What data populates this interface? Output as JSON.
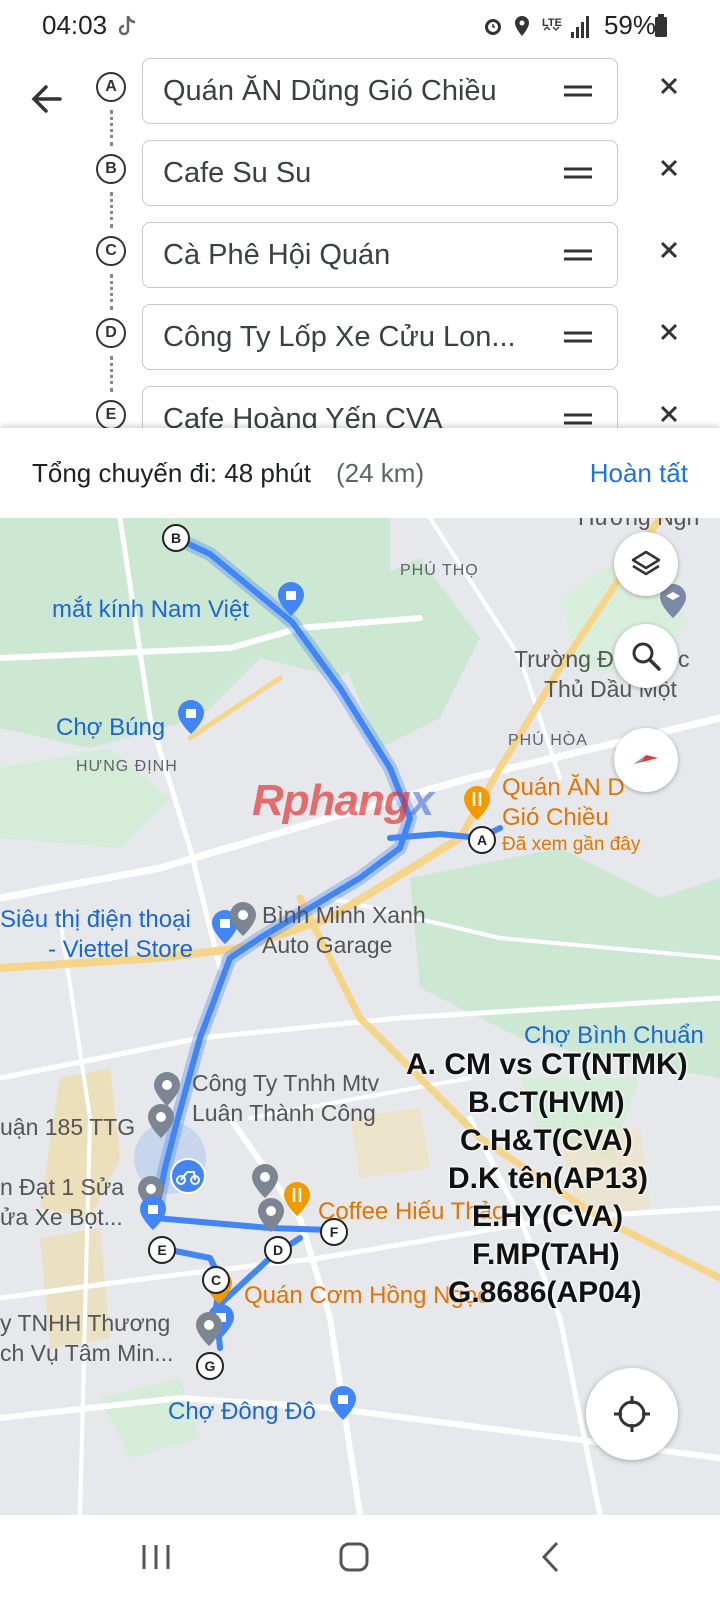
{
  "status_bar": {
    "time": "04:03",
    "battery": "59%",
    "network": "LTE"
  },
  "stops": [
    {
      "letter": "A",
      "name": "Quán ĂN Dũng Gió Chiều"
    },
    {
      "letter": "B",
      "name": "Cafe Su Su"
    },
    {
      "letter": "C",
      "name": "Cà Phê Hội Quán"
    },
    {
      "letter": "D",
      "name": "Công Ty Lốp Xe Cửu Lon..."
    },
    {
      "letter": "E",
      "name": "Cafe Hoàng Yến CVA"
    }
  ],
  "summary": {
    "label": "Tổng chuyến đi: 48 phút",
    "distance": "(24 km)",
    "done": "Hoàn tất"
  },
  "map": {
    "places": {
      "huong_ngh": "Hương Ngh",
      "phu_tho": "PHÚ THỌ",
      "mat_kinh": "mắt kính Nam Việt",
      "truong_1": "Trường Đ",
      "truong_1b": "c",
      "truong_2": "Thủ Dầu Một",
      "cho_bung": "Chợ Búng",
      "phu_hoa": "PHÚ HÒA",
      "hung_dinh": "HƯNG ĐỊNH",
      "quan_an_1": "Quán ĂN D",
      "quan_an_2": "Gió Chiều",
      "da_xem": "Đã xem gần đây",
      "sieu_thi_1": "Siêu thị điện thoại",
      "sieu_thi_2": "- Viettel Store",
      "binh_minh_1": "Bình Minh Xanh",
      "binh_minh_2": "Auto Garage",
      "cho_binh_chuan": "Chợ Bình Chuẩn",
      "cong_ty_1": "Công Ty Tnhh Mtv",
      "cong_ty_2": "Luân Thành Công",
      "uan_185": "uận 185 TTG",
      "dat_1": "n Đạt 1 Sửa",
      "dat_2": "ửa Xe Bọt...",
      "coffee_hieu": "Coffee Hiếu Thảo",
      "quan_com": "Quán Cơm Hồng Ngọc",
      "tnhh_1": "y TNHH Thương",
      "tnhh_2": "ch Vụ Tâm Min...",
      "cho_dong_do": "Chợ Đông Đô"
    },
    "watermark_a": "Rphang",
    "watermark_b": "x",
    "overlay_notes": [
      "A. CM vs CT(NTMK)",
      "B.CT(HVM)",
      "C.H&T(CVA)",
      "D.K tên(AP13)",
      "E.HY(CVA)",
      "F.MP(TAH)",
      "G.8686(AP04)"
    ],
    "markers": [
      "A",
      "B",
      "C",
      "D",
      "E",
      "F",
      "G"
    ]
  },
  "colors": {
    "route": "#4285f4",
    "accent": "#1a73e8",
    "park": "#cde8d2",
    "road_yellow": "#f6d58a"
  }
}
